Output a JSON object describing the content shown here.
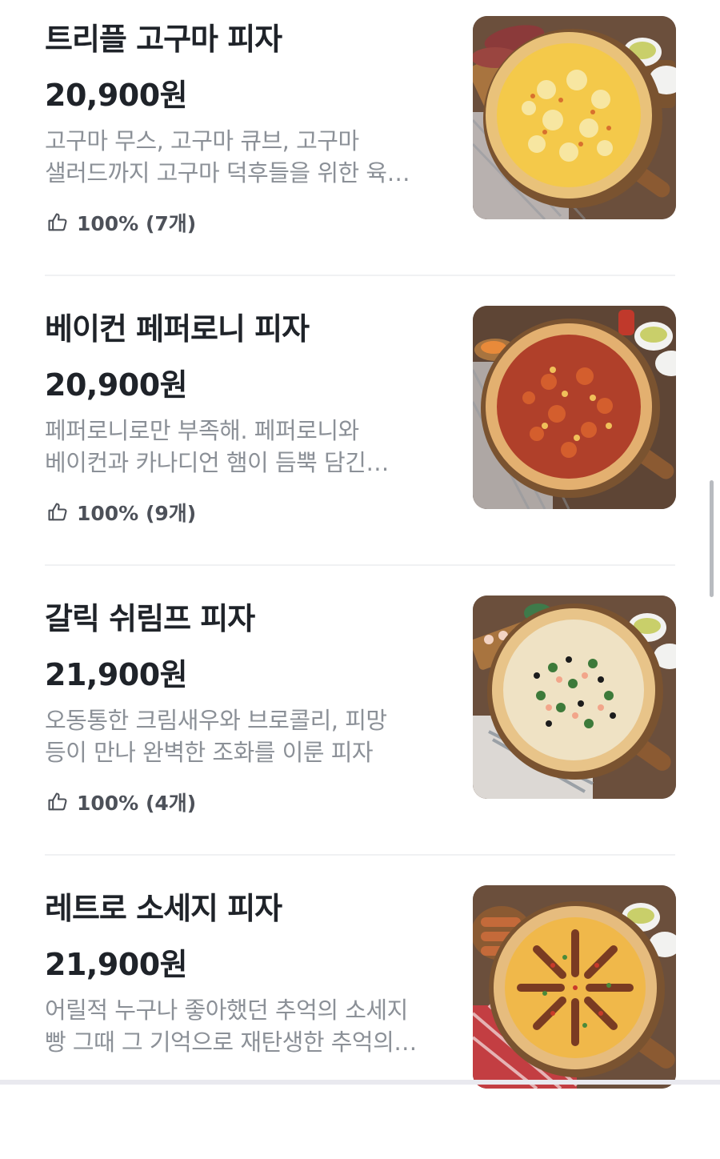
{
  "menu_items": [
    {
      "name": "트리플 고구마 피자",
      "price": "20,900원",
      "description_line1": "고구마 무스, 고구마 큐브, 고구마",
      "description_line2": "샐러드까지 고구마 덕후들을 위한 육…",
      "rating": "100% (7개)",
      "rating_icon": "thumbs-up-icon",
      "image": "pizza-photo",
      "colors": {
        "topping": "#f4c94a",
        "crust": "#e9c27a",
        "accent": "#c98c3a"
      }
    },
    {
      "name": "베이컨 페퍼로니 피자",
      "price": "20,900원",
      "description_line1": "페퍼로니로만 부족해. 페퍼로니와",
      "description_line2": "베이컨과 카나디언 햄이 듬뿍 담긴…",
      "rating": "100% (9개)",
      "rating_icon": "thumbs-up-icon",
      "image": "pizza-photo",
      "colors": {
        "topping": "#b0402a",
        "crust": "#e3b070",
        "accent": "#8c2a1c"
      }
    },
    {
      "name": "갈릭 쉬림프 피자",
      "price": "21,900원",
      "description_line1": "오동통한 크림새우와 브로콜리, 피망",
      "description_line2": "등이 만나 완벽한 조화를 이룬 피자",
      "rating": "100% (4개)",
      "rating_icon": "thumbs-up-icon",
      "image": "pizza-photo",
      "colors": {
        "topping": "#efe2c4",
        "crust": "#e8c489",
        "accent": "#3d7a3a"
      }
    },
    {
      "name": "레트로 소세지 피자",
      "price": "21,900원",
      "description_line1": "어릴적 누구나 좋아했던 추억의 소세지",
      "description_line2": "빵 그때 그 기억으로 재탄생한 추억의…",
      "rating": "",
      "rating_icon": "thumbs-up-icon",
      "image": "pizza-photo",
      "colors": {
        "topping": "#f0b84a",
        "crust": "#e6bc7e",
        "accent": "#7a3b22"
      }
    }
  ]
}
